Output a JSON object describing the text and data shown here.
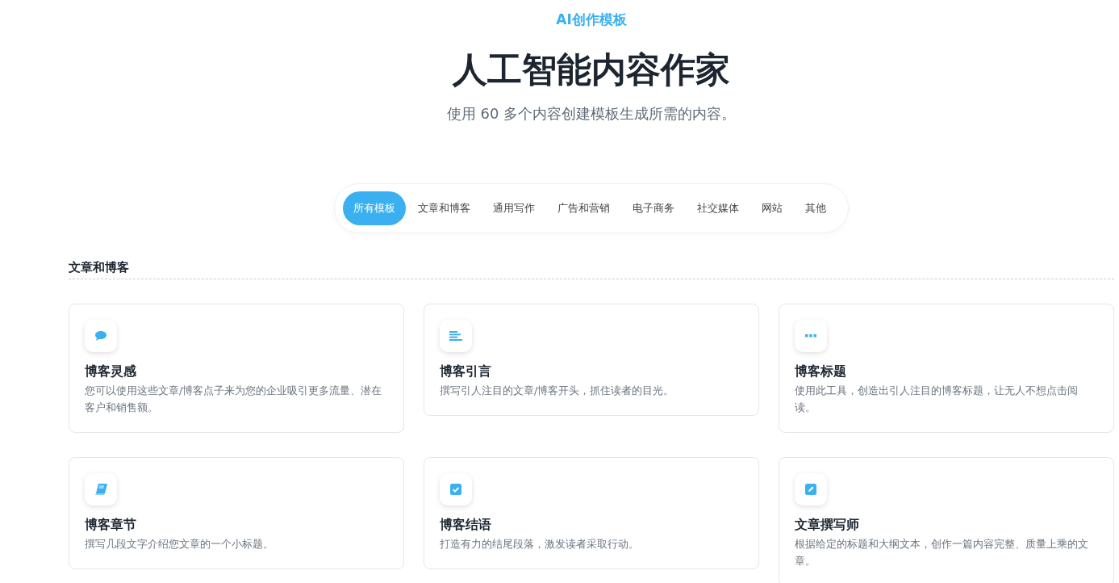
{
  "eyebrow": "AI创作模板",
  "title": "人工智能内容作家",
  "subtitle": "使用 60 多个内容创建模板生成所需的内容。",
  "tabs": [
    {
      "label": "所有模板",
      "selected": true
    },
    {
      "label": "文章和博客",
      "selected": false
    },
    {
      "label": "通用写作",
      "selected": false
    },
    {
      "label": "广告和营销",
      "selected": false
    },
    {
      "label": "电子商务",
      "selected": false
    },
    {
      "label": "社交媒体",
      "selected": false
    },
    {
      "label": "网站",
      "selected": false
    },
    {
      "label": "其他",
      "selected": false
    }
  ],
  "section": {
    "title": "文章和博客",
    "cards": [
      {
        "kind": "chat",
        "title": "博客灵感",
        "description": "您可以使用这些文章/博客点子来为您的企业吸引更多流量、潜在客户和销售额。"
      },
      {
        "kind": "lines",
        "title": "博客引言",
        "description": "撰写引人注目的文章/博客开头，抓住读者的目光。"
      },
      {
        "kind": "dots",
        "title": "博客标题",
        "description": "使用此工具，创造出引人注目的博客标题，让无人不想点击阅读。"
      },
      {
        "kind": "book",
        "title": "博客章节",
        "description": "撰写几段文字介绍您文章的一个小标题。"
      },
      {
        "kind": "check",
        "title": "博客结语",
        "description": "打造有力的结尾段落，激发读者采取行动。"
      },
      {
        "kind": "pencil",
        "title": "文章撰写师",
        "description": "根据给定的标题和大纲文本，创作一篇内容完整、质量上乘的文章。"
      }
    ]
  }
}
